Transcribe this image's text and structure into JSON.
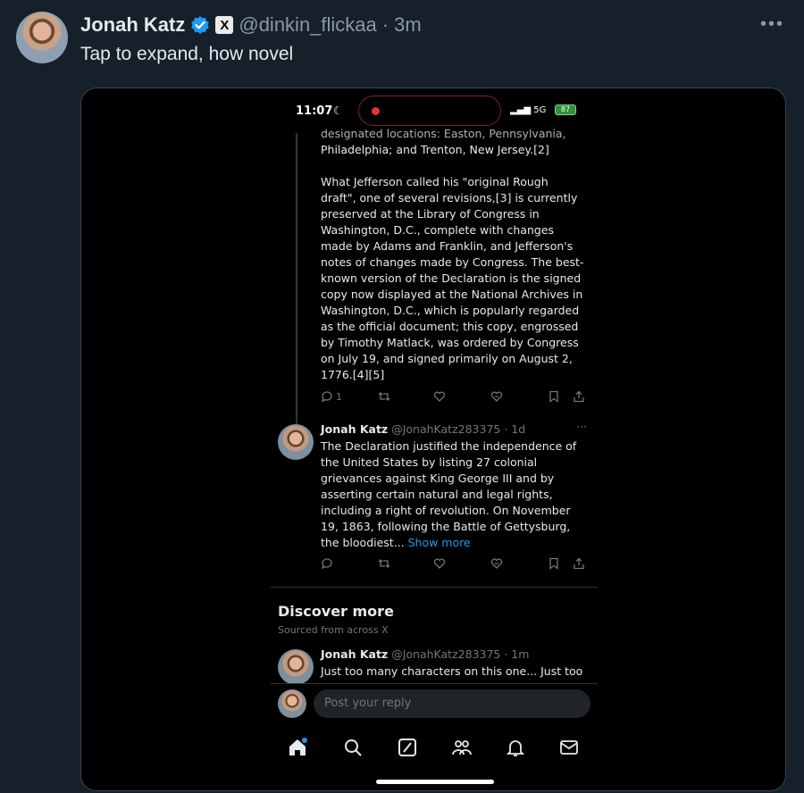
{
  "post": {
    "author_name": "Jonah Katz",
    "handle": "@dinkin_flickaa",
    "separator": "·",
    "time_ago": "3m",
    "text": "Tap to expand, how novel",
    "more_icon": "more-horizontal-icon",
    "x_badge": "X"
  },
  "phone": {
    "status": {
      "time": "11:07",
      "network": "5G",
      "battery": "87"
    },
    "tweet_clip_lines": [
      "designated locations: Easton, Pennsylvania,",
      "Philadelphia; and Trenton, New Jersey.[2]"
    ],
    "tweet_paragraph": "What Jefferson called his \"original Rough draft\", one of several revisions,[3] is currently preserved at the Library of Congress in Washington, D.C., complete with changes made by Adams and Franklin, and Jefferson's notes of changes made by Congress. The best-known version of the Declaration is the signed copy now displayed at the National Archives in Washington, D.C., which is popularly regarded as the official document; this copy, engrossed by Timothy Matlack, was ordered by Congress on July 19, and signed primarily on August 2, 1776.[4][5]",
    "tweet_actions": {
      "reply_count": "1"
    },
    "reply": {
      "name": "Jonah Katz",
      "handle": "@JonahKatz283375",
      "time": "· 1d",
      "text": "The Declaration justified the independence of the United States by listing 27 colonial grievances against King George III and by asserting certain natural and legal rights, including a right of revolution. On November 19, 1863, following the Battle of Gettysburg, the bloodiest...",
      "show_more": "Show more"
    },
    "discover": {
      "title": "Discover more",
      "subtitle": "Sourced from across X",
      "item": {
        "name": "Jonah Katz",
        "handle": "@JonahKatz283375",
        "time": "· 1m",
        "text": "Just too many characters on this one... Just too"
      }
    },
    "reply_input_placeholder": "Post your reply",
    "tabs": [
      "home-icon",
      "search-icon",
      "grok-icon",
      "communities-icon",
      "notifications-icon",
      "messages-icon"
    ]
  },
  "colors": {
    "background": "#15202b",
    "media_bg": "#000000",
    "accent": "#1d9bf0",
    "muted": "#71767b",
    "island_border": "#8a1d1d"
  }
}
